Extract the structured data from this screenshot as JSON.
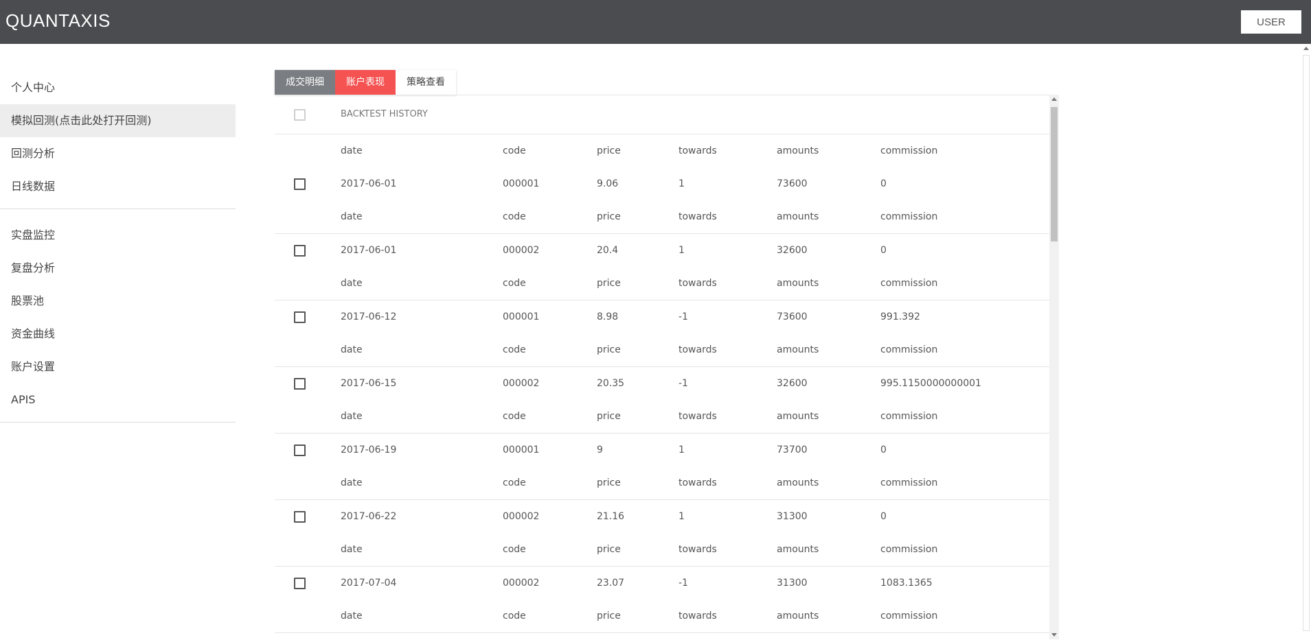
{
  "app": {
    "title": "QUANTAXIS",
    "user_button": "USER"
  },
  "sidebar": {
    "group1": [
      {
        "label": "个人中心",
        "active": false
      },
      {
        "label": "模拟回测(点击此处打开回测)",
        "active": true
      },
      {
        "label": "回测分析",
        "active": false
      },
      {
        "label": "日线数据",
        "active": false
      }
    ],
    "group2": [
      {
        "label": "实盘监控"
      },
      {
        "label": "复盘分析"
      },
      {
        "label": "股票池"
      },
      {
        "label": "资金曲线"
      },
      {
        "label": "账户设置"
      },
      {
        "label": "APIS"
      }
    ]
  },
  "tabs": [
    {
      "label": "成交明细",
      "color": "#7a7d82"
    },
    {
      "label": "账户表现",
      "color": "#f55252"
    },
    {
      "label": "策略查看",
      "color": "#ffffff"
    }
  ],
  "table": {
    "title": "BACKTEST HISTORY",
    "columns": [
      "date",
      "code",
      "price",
      "towards",
      "amounts",
      "commission"
    ],
    "rows": [
      {
        "date": "2017-06-01",
        "code": "000001",
        "price": "9.06",
        "towards": "1",
        "amounts": "73600",
        "commission": "0"
      },
      {
        "date": "2017-06-01",
        "code": "000002",
        "price": "20.4",
        "towards": "1",
        "amounts": "32600",
        "commission": "0"
      },
      {
        "date": "2017-06-12",
        "code": "000001",
        "price": "8.98",
        "towards": "-1",
        "amounts": "73600",
        "commission": "991.392"
      },
      {
        "date": "2017-06-15",
        "code": "000002",
        "price": "20.35",
        "towards": "-1",
        "amounts": "32600",
        "commission": "995.1150000000001"
      },
      {
        "date": "2017-06-19",
        "code": "000001",
        "price": "9",
        "towards": "1",
        "amounts": "73700",
        "commission": "0"
      },
      {
        "date": "2017-06-22",
        "code": "000002",
        "price": "21.16",
        "towards": "1",
        "amounts": "31300",
        "commission": "0"
      },
      {
        "date": "2017-07-04",
        "code": "000002",
        "price": "23.07",
        "towards": "-1",
        "amounts": "31300",
        "commission": "1083.1365"
      }
    ]
  }
}
